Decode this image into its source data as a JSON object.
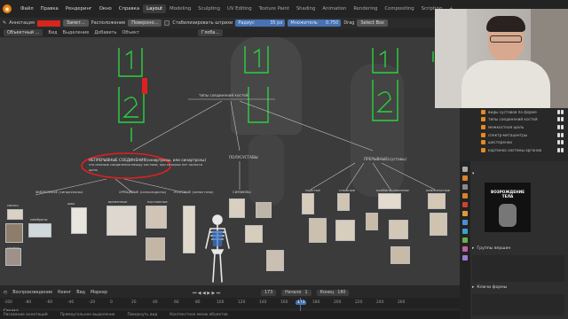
{
  "menu": {
    "items": [
      "Файл",
      "Правка",
      "Рендеринг",
      "Окно",
      "Справка"
    ],
    "workspaces": [
      "Layout",
      "Modeling",
      "Sculpting",
      "UV Editing",
      "Texture Paint",
      "Shading",
      "Animation",
      "Rendering",
      "Compositing",
      "Scripting"
    ],
    "active_workspace": "Layout"
  },
  "toolbar": {
    "mode": "Объектный ...",
    "annotation_label": "Аннотация",
    "placement_label": "Замет...",
    "placement_field": "Расположение",
    "surface": "Поверхно...",
    "stabilize": "Стабилизировать штрихи",
    "radius_label": "Радиус",
    "radius_value": "35 px",
    "factor_label": "Множитель",
    "factor_value": "0.750",
    "drag_label": "Drag",
    "drag_value": "Select Box",
    "global": "Глоба...",
    "annotation_color": "#d7261f"
  },
  "toolbar2": {
    "items": [
      "Вид",
      "Выделение",
      "Добавить",
      "Объект"
    ]
  },
  "canvas": {
    "root_title": "типы соединений костей",
    "branch_left": "НЕПРЕРЫВНЫЕ СОЕДИНЕНИЯ(синартрозы, или синартрозы)",
    "branch_left_desc": "это связные соединения между костями, при которых нет полости",
    "branch_left_desc2": "щель",
    "branch_mid": "ПОЛУСУСТАВЫ",
    "branch_right": "ПРЕРЫВНЫЕ(суставы)",
    "sub_1": "ФИБРОЗНЫЕ (синдесмозы)",
    "sub_2": "ХРЯЩЕВЫЕ (синхондрозы)",
    "sub_3": "КОСТНЫЕ (синостозы)",
    "sub_4": "СИМФИЗЫ",
    "sub_5": "простые",
    "sub_6": "сложные",
    "sub_7": "комбинированные",
    "sub_8": "комплексные",
    "sub_9": "комбинированные",
    "small_1": "связки",
    "small_2": "мембраны",
    "small_3": "швы",
    "small_4": "гомфоз",
    "small_5": "временные",
    "small_6": "постоянные"
  },
  "outliner": {
    "rows": [
      "виды суставов по форме",
      "типы соединений костей",
      "межкостная щель",
      "спектр-метацентры",
      "шестеренки",
      "картинка системы органов"
    ]
  },
  "properties": {
    "vertex_groups_label": "Группы вершин",
    "shape_keys_label": "Ключи формы",
    "thumbnail_title": "ВОЗРОЖДЕНИЕ ТЕЛА"
  },
  "timeline": {
    "playback": "Воспроизведение",
    "keying": "Кеинг",
    "view": "Вид",
    "marker": "Маркер",
    "current_frame": "173",
    "start_label": "Начало",
    "start_value": "1",
    "end_label": "Конец",
    "end_value": "180",
    "ticks": [
      "-100",
      "-80",
      "-60",
      "-40",
      "-20",
      "0",
      "20",
      "40",
      "60",
      "80",
      "100",
      "120",
      "140",
      "160",
      "173",
      "180",
      "200",
      "220",
      "240",
      "260"
    ],
    "track_label": "Сводка"
  },
  "statusbar": {
    "items": [
      "Рисование аннотаций",
      "Прямоугольное выделение",
      "Повернуть вид",
      "Контекстное меню объектов"
    ]
  },
  "colors": {
    "accent_orange": "#e87d0d",
    "annotation_green": "#2bd13f",
    "annotation_red": "#e02020",
    "selection_blue": "#4772b3"
  }
}
